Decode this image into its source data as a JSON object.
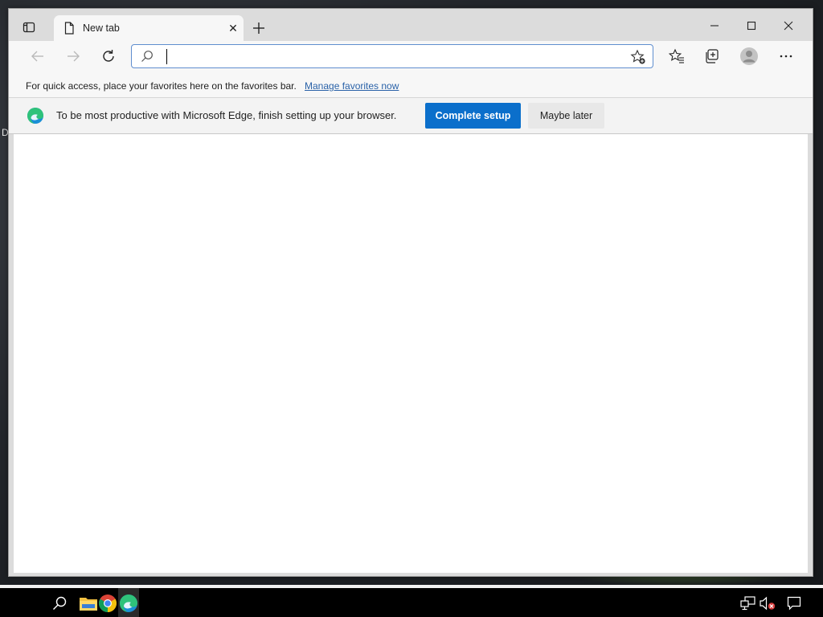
{
  "desktop": {
    "edge_letter": "D"
  },
  "tab": {
    "title": "New tab",
    "close_glyph": "✕"
  },
  "address_bar": {
    "value": "",
    "placeholder": ""
  },
  "favorites_bar": {
    "text": "For quick access, place your favorites here on the favorites bar.",
    "link": "Manage favorites now"
  },
  "banner": {
    "message": "To be most productive with Microsoft Edge, finish setting up your browser.",
    "primary_button": "Complete setup",
    "secondary_button": "Maybe later"
  },
  "icons": {
    "tab_actions": "tab-actions-icon",
    "new_tab": "plus-icon",
    "minimize": "minimize-icon",
    "maximize": "maximize-icon",
    "close": "close-icon",
    "back": "back-arrow-icon",
    "forward": "forward-arrow-icon",
    "refresh": "refresh-icon",
    "search": "search-icon",
    "add_favorite": "add-favorite-icon",
    "favorites": "favorites-icon",
    "collections": "collections-icon",
    "profile": "profile-icon",
    "more": "more-icon",
    "taskbar_search": "search-icon",
    "file_explorer": "folder-icon",
    "chrome": "chrome-icon",
    "edge": "edge-icon",
    "network": "network-icon",
    "volume_muted": "volume-muted-icon",
    "notifications": "notifications-icon"
  },
  "colors": {
    "primary_button": "#0b6fcb",
    "link": "#2a62a8",
    "address_focus_border": "#5f8ecf"
  }
}
